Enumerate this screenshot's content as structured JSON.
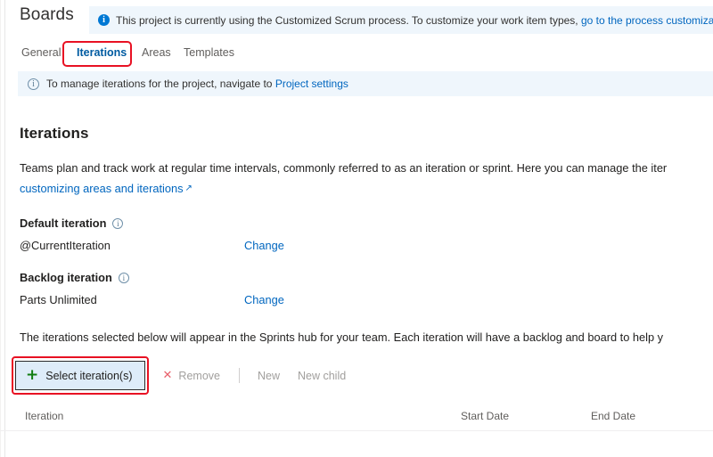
{
  "header": {
    "hub_title": "Boards",
    "banner": {
      "icon": "info-filled-icon",
      "text_before": "This project is currently using the Customized Scrum process. To customize your work item types, ",
      "link_text": "go to the process customization"
    }
  },
  "tabs": [
    {
      "label": "General",
      "selected": false
    },
    {
      "label": "Iterations",
      "selected": true
    },
    {
      "label": "Areas",
      "selected": false
    },
    {
      "label": "Templates",
      "selected": false
    }
  ],
  "info_strip": {
    "icon": "info-outline-icon",
    "text_before": "To manage iterations for the project, navigate to ",
    "link_text": "Project settings"
  },
  "main": {
    "page_title": "Iterations",
    "intro_line1": "Teams plan and track work at regular time intervals, commonly referred to as an iteration or sprint. Here you can manage the iter",
    "intro_line2_link": "customizing areas and iterations",
    "external_link_glyph": "↗",
    "default_iteration": {
      "label": "Default iteration",
      "value": "@CurrentIteration",
      "change_label": "Change"
    },
    "backlog_iteration": {
      "label": "Backlog iteration",
      "value": "Parts Unlimited",
      "change_label": "Change"
    },
    "hint": "The iterations selected below will appear in the Sprints hub for your team. Each iteration will have a backlog and board to help y"
  },
  "command_bar": {
    "select_button": {
      "icon": "plus-icon",
      "label": "Select iteration(s)"
    },
    "remove": {
      "icon": "close-x-icon",
      "label": "Remove",
      "disabled": true
    },
    "new": {
      "label": "New",
      "disabled": true
    },
    "new_child": {
      "label": "New child",
      "disabled": true
    }
  },
  "table": {
    "columns": [
      "Iteration",
      "Start Date",
      "End Date"
    ],
    "rows": []
  },
  "annotations": {
    "color": "#e81123",
    "targets": [
      "tab-iterations",
      "select-iterations-button"
    ]
  }
}
